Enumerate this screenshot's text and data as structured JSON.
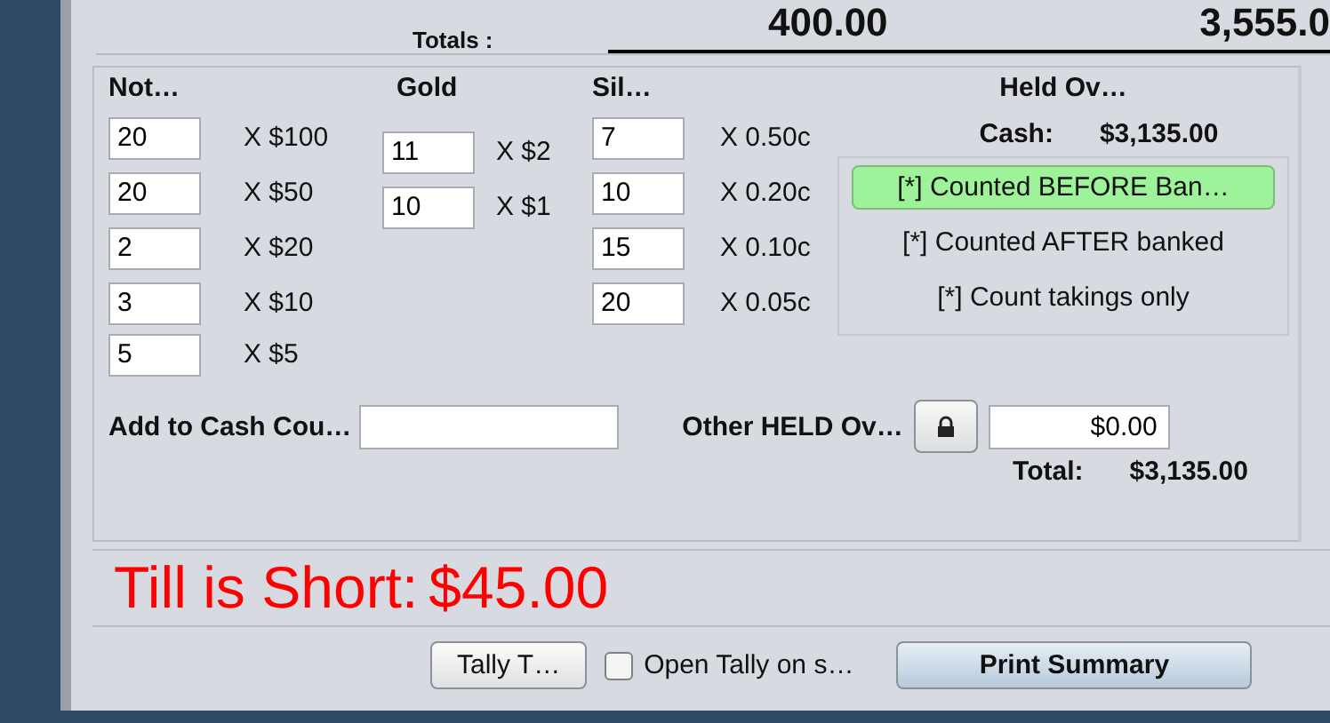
{
  "totals": {
    "label": "Totals :",
    "values": [
      "400.00",
      "3,555.0"
    ]
  },
  "notes": {
    "title": "Not…",
    "rows": [
      {
        "count": "20",
        "denomination": "X $100"
      },
      {
        "count": "20",
        "denomination": "X $50"
      },
      {
        "count": "2",
        "denomination": "X $20"
      },
      {
        "count": "3",
        "denomination": "X $10"
      },
      {
        "count": "5",
        "denomination": "X $5"
      }
    ]
  },
  "gold": {
    "title": "Gold",
    "rows": [
      {
        "count": "11",
        "denomination": "X $2"
      },
      {
        "count": "10",
        "denomination": "X $1"
      }
    ]
  },
  "silver": {
    "title": "Sil…",
    "rows": [
      {
        "count": "7",
        "denomination": "X 0.50c"
      },
      {
        "count": "10",
        "denomination": "X 0.20c"
      },
      {
        "count": "15",
        "denomination": "X 0.10c"
      },
      {
        "count": "20",
        "denomination": "X 0.05c"
      }
    ]
  },
  "held_over": {
    "title": "Held Ov…",
    "cash_label": "Cash:",
    "cash": "$3,135.00",
    "options": [
      {
        "label": "[*] Counted BEFORE Ban…",
        "selected": true
      },
      {
        "label": "[*] Counted AFTER banked",
        "selected": false
      },
      {
        "label": "[*] Count takings only",
        "selected": false
      }
    ]
  },
  "add_to_cash": {
    "label": "Add to Cash Cou…"
  },
  "other_held": {
    "label": "Other HELD Ov…",
    "value": "$0.00"
  },
  "total": {
    "label": "Total:",
    "value": "$3,135.00"
  },
  "status": {
    "label": "Till is Short:",
    "amount": "$45.00"
  },
  "footer": {
    "tally_button": "Tally T…",
    "open_tally": {
      "label": "Open Tally on s…",
      "checked": false
    },
    "print_button": "Print Summary"
  }
}
